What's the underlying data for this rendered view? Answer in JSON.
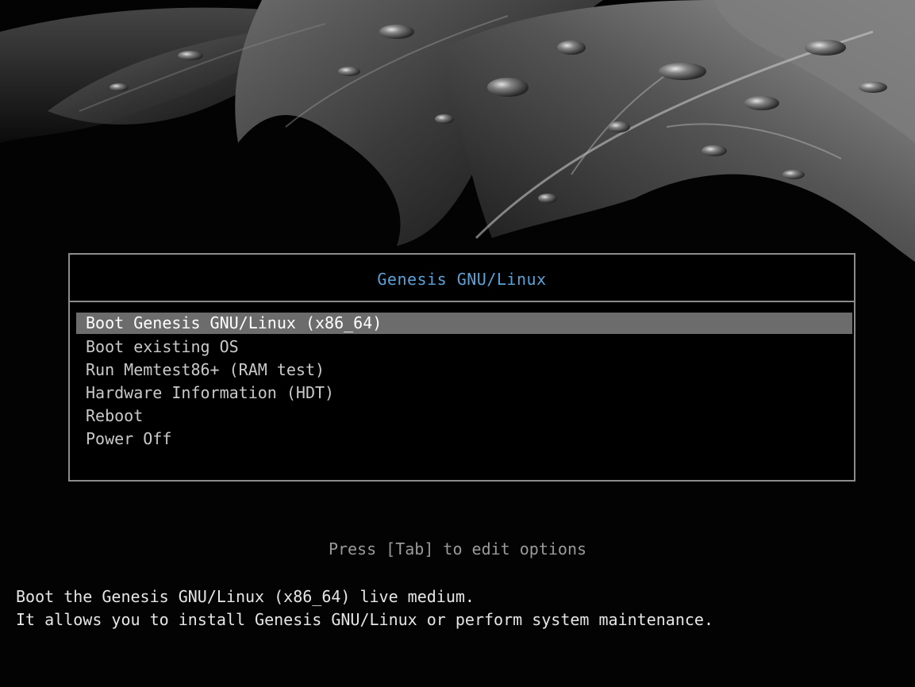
{
  "menu": {
    "title": "Genesis GNU/Linux",
    "items": [
      {
        "label": "Boot Genesis GNU/Linux (x86_64)",
        "selected": true
      },
      {
        "label": "Boot existing OS",
        "selected": false
      },
      {
        "label": "Run Memtest86+ (RAM test)",
        "selected": false
      },
      {
        "label": "Hardware Information (HDT)",
        "selected": false
      },
      {
        "label": "Reboot",
        "selected": false
      },
      {
        "label": "Power Off",
        "selected": false
      }
    ]
  },
  "hint": "Press [Tab] to edit options",
  "help": {
    "line1": "Boot the Genesis GNU/Linux (x86_64) live medium.",
    "line2": "It allows you to install Genesis GNU/Linux or perform system maintenance."
  },
  "colors": {
    "background": "#030303",
    "title": "#5aa2d8",
    "item_text": "#c9c9c9",
    "selected_bg": "#6c6c6c",
    "border": "#8c8c8c"
  },
  "icons": {
    "background": "wet-leaves-image"
  }
}
